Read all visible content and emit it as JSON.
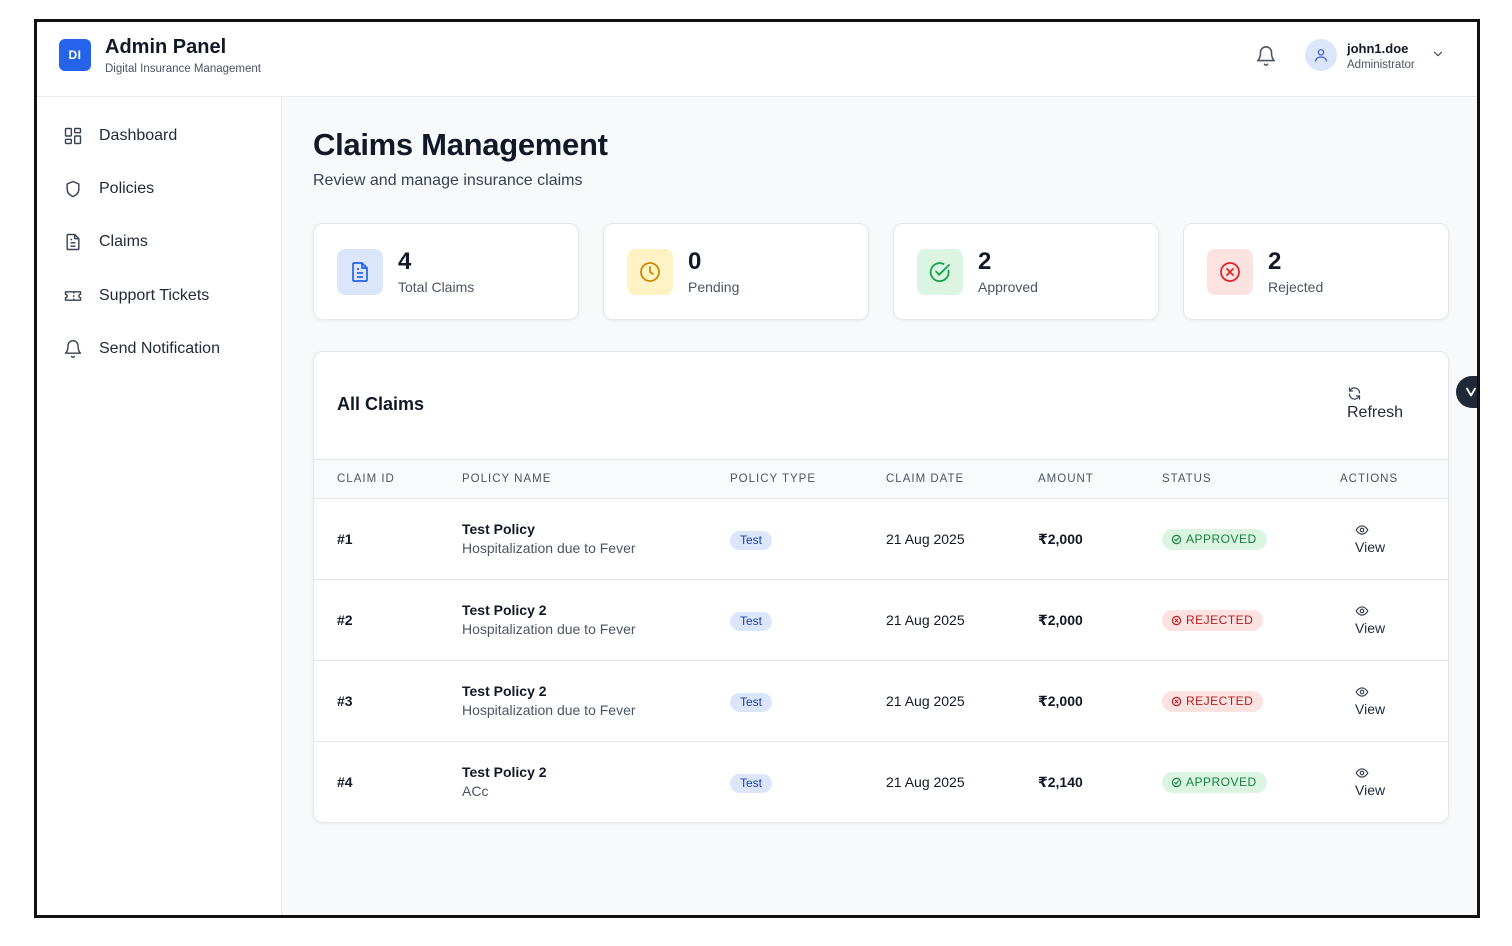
{
  "header": {
    "logo_text": "DI",
    "title": "Admin Panel",
    "subtitle": "Digital Insurance Management",
    "user_name": "john1.doe",
    "user_role": "Administrator"
  },
  "sidebar": {
    "items": [
      {
        "label": "Dashboard",
        "icon": "dashboard-grid-icon"
      },
      {
        "label": "Policies",
        "icon": "shield-icon"
      },
      {
        "label": "Claims",
        "icon": "document-icon"
      },
      {
        "label": "Support Tickets",
        "icon": "ticket-icon"
      },
      {
        "label": "Send Notification",
        "icon": "bell-icon"
      }
    ]
  },
  "main": {
    "title": "Claims Management",
    "subtitle": "Review and manage insurance claims"
  },
  "stats": [
    {
      "value": "4",
      "label": "Total Claims",
      "icon": "document-icon",
      "bg": "#dbe6fb",
      "color": "#2563eb"
    },
    {
      "value": "0",
      "label": "Pending",
      "icon": "clock-icon",
      "bg": "#fdf3c4",
      "color": "#ca8a04"
    },
    {
      "value": "2",
      "label": "Approved",
      "icon": "check-circle-icon",
      "bg": "#dcf5e3",
      "color": "#16a34a"
    },
    {
      "value": "2",
      "label": "Rejected",
      "icon": "x-circle-icon",
      "bg": "#fde2e2",
      "color": "#dc2626"
    }
  ],
  "claims_table": {
    "title": "All Claims",
    "refresh_label": "Refresh",
    "columns": [
      "CLAIM ID",
      "POLICY NAME",
      "POLICY TYPE",
      "CLAIM DATE",
      "AMOUNT",
      "STATUS",
      "ACTIONS"
    ],
    "rows": [
      {
        "id": "#1",
        "policy_name": "Test Policy",
        "description": "Hospitalization due to Fever",
        "type": "Test",
        "date": "21 Aug 2025",
        "amount": "₹2,000",
        "status": "APPROVED",
        "action": "View"
      },
      {
        "id": "#2",
        "policy_name": "Test Policy 2",
        "description": "Hospitalization due to Fever",
        "type": "Test",
        "date": "21 Aug 2025",
        "amount": "₹2,000",
        "status": "REJECTED",
        "action": "View"
      },
      {
        "id": "#3",
        "policy_name": "Test Policy 2",
        "description": "Hospitalization due to Fever",
        "type": "Test",
        "date": "21 Aug 2025",
        "amount": "₹2,000",
        "status": "REJECTED",
        "action": "View"
      },
      {
        "id": "#4",
        "policy_name": "Test Policy 2",
        "description": "ACc",
        "type": "Test",
        "date": "21 Aug 2025",
        "amount": "₹2,140",
        "status": "APPROVED",
        "action": "View"
      }
    ]
  },
  "colors": {
    "accent": "#2563eb",
    "approved": "#15803d",
    "rejected": "#b91c1c"
  }
}
